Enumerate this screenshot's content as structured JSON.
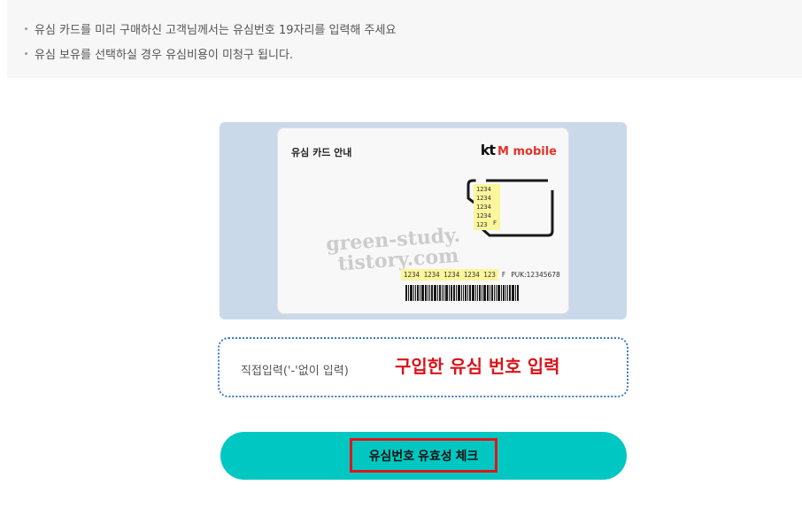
{
  "notice": {
    "items": [
      "유심 카드를 미리 구매하신 고객님께서는 유심번호 19자리를 입력해 주세요",
      "유심 보유를 선택하실 경우 유심비용이 미청구 됩니다."
    ]
  },
  "sim_card": {
    "title": "유심 카드 안내",
    "brand_kt": "kt",
    "brand_mobile": "M mobile",
    "chip_numbers": [
      "1234",
      "1234",
      "1234",
      "1234",
      "123"
    ],
    "chip_suffix": "F",
    "serial_highlight": "1234 1234 1234 1234 123",
    "serial_suffix": "F",
    "puk": "PUK:12345678",
    "watermark_line1": "green-study.",
    "watermark_line2": "tistory.com"
  },
  "input": {
    "placeholder": "직접입력('-'없이 입력)",
    "value": "",
    "annotation": "구입한 유심 번호 입력",
    "border_color": "#3a7bbf"
  },
  "check_button": {
    "label": "유심번호 유효성 체크",
    "color": "#00c7c2",
    "highlight_color": "#e0151c"
  }
}
